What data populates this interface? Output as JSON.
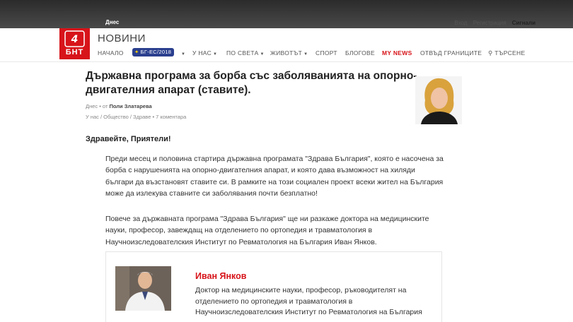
{
  "topbar": {
    "today": "Днес"
  },
  "header": {
    "logo_text": "БНТ",
    "site_title": "НОВИНИ",
    "user_links": {
      "login": "Вход",
      "register": "Регистрация",
      "signals": "Сигнали"
    }
  },
  "nav": {
    "home": "НАЧАЛО",
    "presidency": "БГ-ЕС/2018",
    "at_home": "У НАС",
    "world": "ПО СВЕТА",
    "life": "ЖИВОТЪТ",
    "sport": "СПОРТ",
    "blogs": "БЛОГОВЕ",
    "my_news": "MY NEWS",
    "beyond": "ОТВЪД ГРАНИЦИТЕ",
    "search": "ТЪРСЕНЕ"
  },
  "article": {
    "title": "Държавна програма за борба със заболяванията на опорно-двигателния апарат (ставите).",
    "meta_prefix": "Днес • от",
    "author": "Поли Златарева",
    "breadcrumbs": "У нас / Общество / Здраве • 7 коментара",
    "greeting": "Здравейте, Приятели!",
    "paragraph1": "Преди месец и половина стартира държавна програмата \"Здрава България\", която е насочена за борба с нарушенията на опорно-двигателния апарат, и която дава възможност на хиляди българи да възстановят ставите си. В рамките на този социален проект всеки жител на България може да излекува ставните си заболявания почти безплатно!",
    "paragraph2": "Повече за държавната програма \"Здрава България\" ще ни разкаже доктора на медицинските науки, професор, завеждащ на отделението по ортопедия и травматология в Научноизследователския Институт по Ревматология на България Иван Янков."
  },
  "bio": {
    "name": "Иван Янков",
    "text": "Доктор на медицинските науки, професор, ръководителят на отделението по ортопедия и травматология в Научноизследователския Институт по Ревматология на България"
  },
  "colors": {
    "brand_red": "#d7141a",
    "presidency_blue": "#2a3f8e"
  }
}
